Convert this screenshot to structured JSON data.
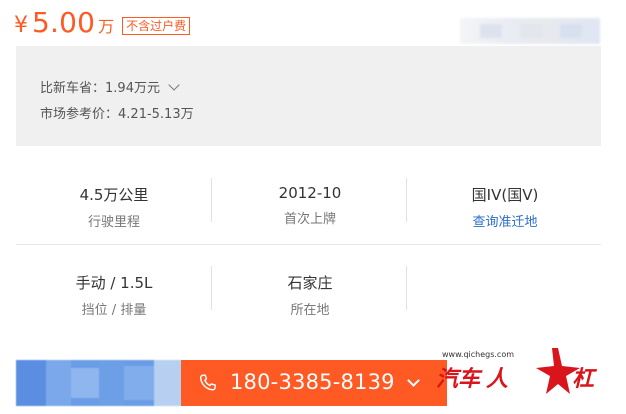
{
  "price": {
    "currency": "¥",
    "value": "5.00",
    "unit": "万",
    "note": "不含过户费"
  },
  "summary": {
    "savings_label": "比新车省：",
    "savings_value": "1.94万元",
    "market_label": "市场参考价：",
    "market_value": "4.21-5.13万"
  },
  "specs": [
    {
      "value": "4.5万公里",
      "label": "行驶里程"
    },
    {
      "value": "2012-10",
      "label": "首次上牌"
    },
    {
      "value": "国IV(国V)",
      "label": "查询准迁地"
    },
    {
      "value": "手动 / 1.5L",
      "label": "挡位 / 排量"
    },
    {
      "value": "石家庄",
      "label": "所在地"
    }
  ],
  "contact": {
    "phone": "180-3385-8139"
  },
  "watermark": {
    "url": "www.qichegs.com",
    "logo_text": "汽车人杠"
  },
  "colors": {
    "accent": "#ff5a23",
    "link": "#2b6ec9",
    "panel_bg": "#f0f0f0"
  },
  "icons": [
    "phone-icon",
    "chevron-down-icon"
  ]
}
